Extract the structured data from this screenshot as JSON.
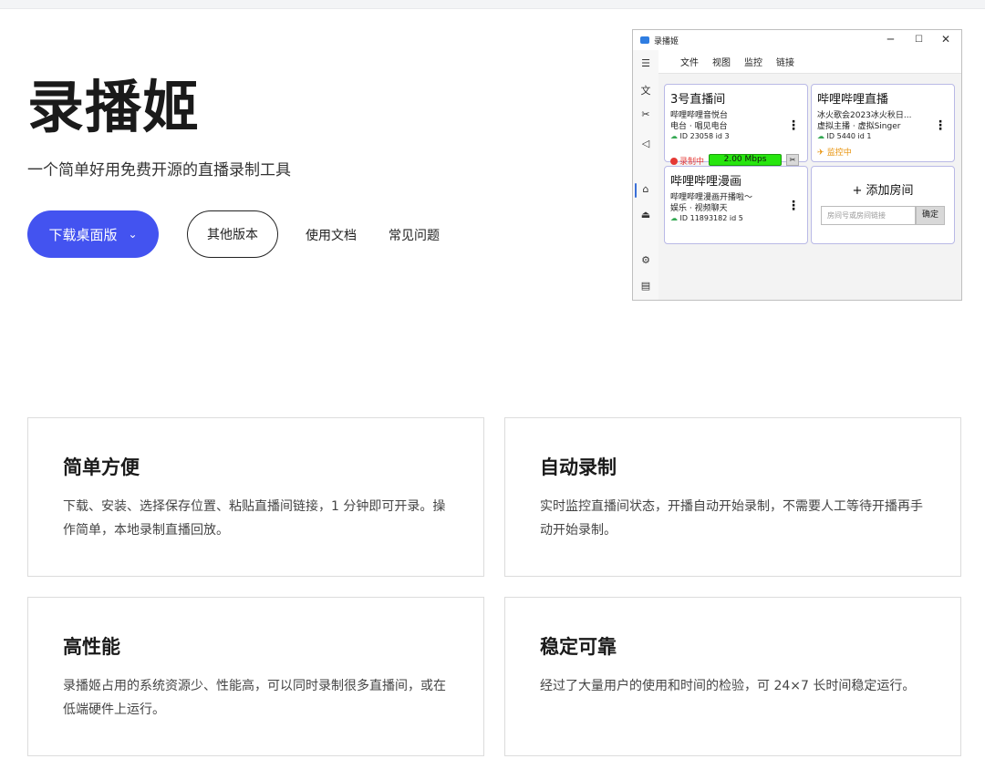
{
  "hero": {
    "title": "录播姬",
    "subtitle": "一个简单好用免费开源的直播录制工具",
    "download_label": "下载桌面版",
    "other_versions_label": "其他版本",
    "docs_label": "使用文档",
    "faq_label": "常见问题"
  },
  "app_window": {
    "title": "录播姬",
    "controls": {
      "min": "─",
      "max": "☐",
      "close": "✕"
    },
    "menu": [
      "文件",
      "视图",
      "监控",
      "链接"
    ],
    "rooms": [
      {
        "name": "3号直播间",
        "line1": "哔哩哔哩音悦台",
        "line2": "电台 · 唱见电台",
        "meta": "ID 23058  id 3",
        "status": "录制中",
        "bitrate": "2.00 Mbps"
      },
      {
        "name": "哔哩哔哩直播",
        "line1": "冰火歌会2023冰火秋日...",
        "line2": "虚拟主播 · 虚拟Singer",
        "meta": "ID 5440  id 1",
        "status": "监控中"
      },
      {
        "name": "哔哩哔哩漫画",
        "line1": "哔哩哔哩漫画开播啦～",
        "line2": "娱乐 · 视频聊天",
        "meta": "ID 11893182  id 5"
      }
    ],
    "add_room": {
      "title": "+ 添加房间",
      "placeholder": "房间号或房间链接",
      "confirm": "确定"
    }
  },
  "features": [
    {
      "title": "简单方便",
      "desc": "下载、安装、选择保存位置、粘贴直播间链接，1 分钟即可开录。操作简单，本地录制直播回放。"
    },
    {
      "title": "自动录制",
      "desc": "实时监控直播间状态，开播自动开始录制，不需要人工等待开播再手动开始录制。"
    },
    {
      "title": "高性能",
      "desc": "录播姬占用的系统资源少、性能高，可以同时录制很多直播间，或在低端硬件上运行。"
    },
    {
      "title": "稳定可靠",
      "desc": "经过了大量用户的使用和时间的检验，可 24×7 长时间稳定运行。"
    }
  ],
  "colors": {
    "primary": "#4353f0",
    "recording": "#e53935",
    "bitrate_bg": "#27e60f",
    "monitoring": "#e8930c"
  }
}
